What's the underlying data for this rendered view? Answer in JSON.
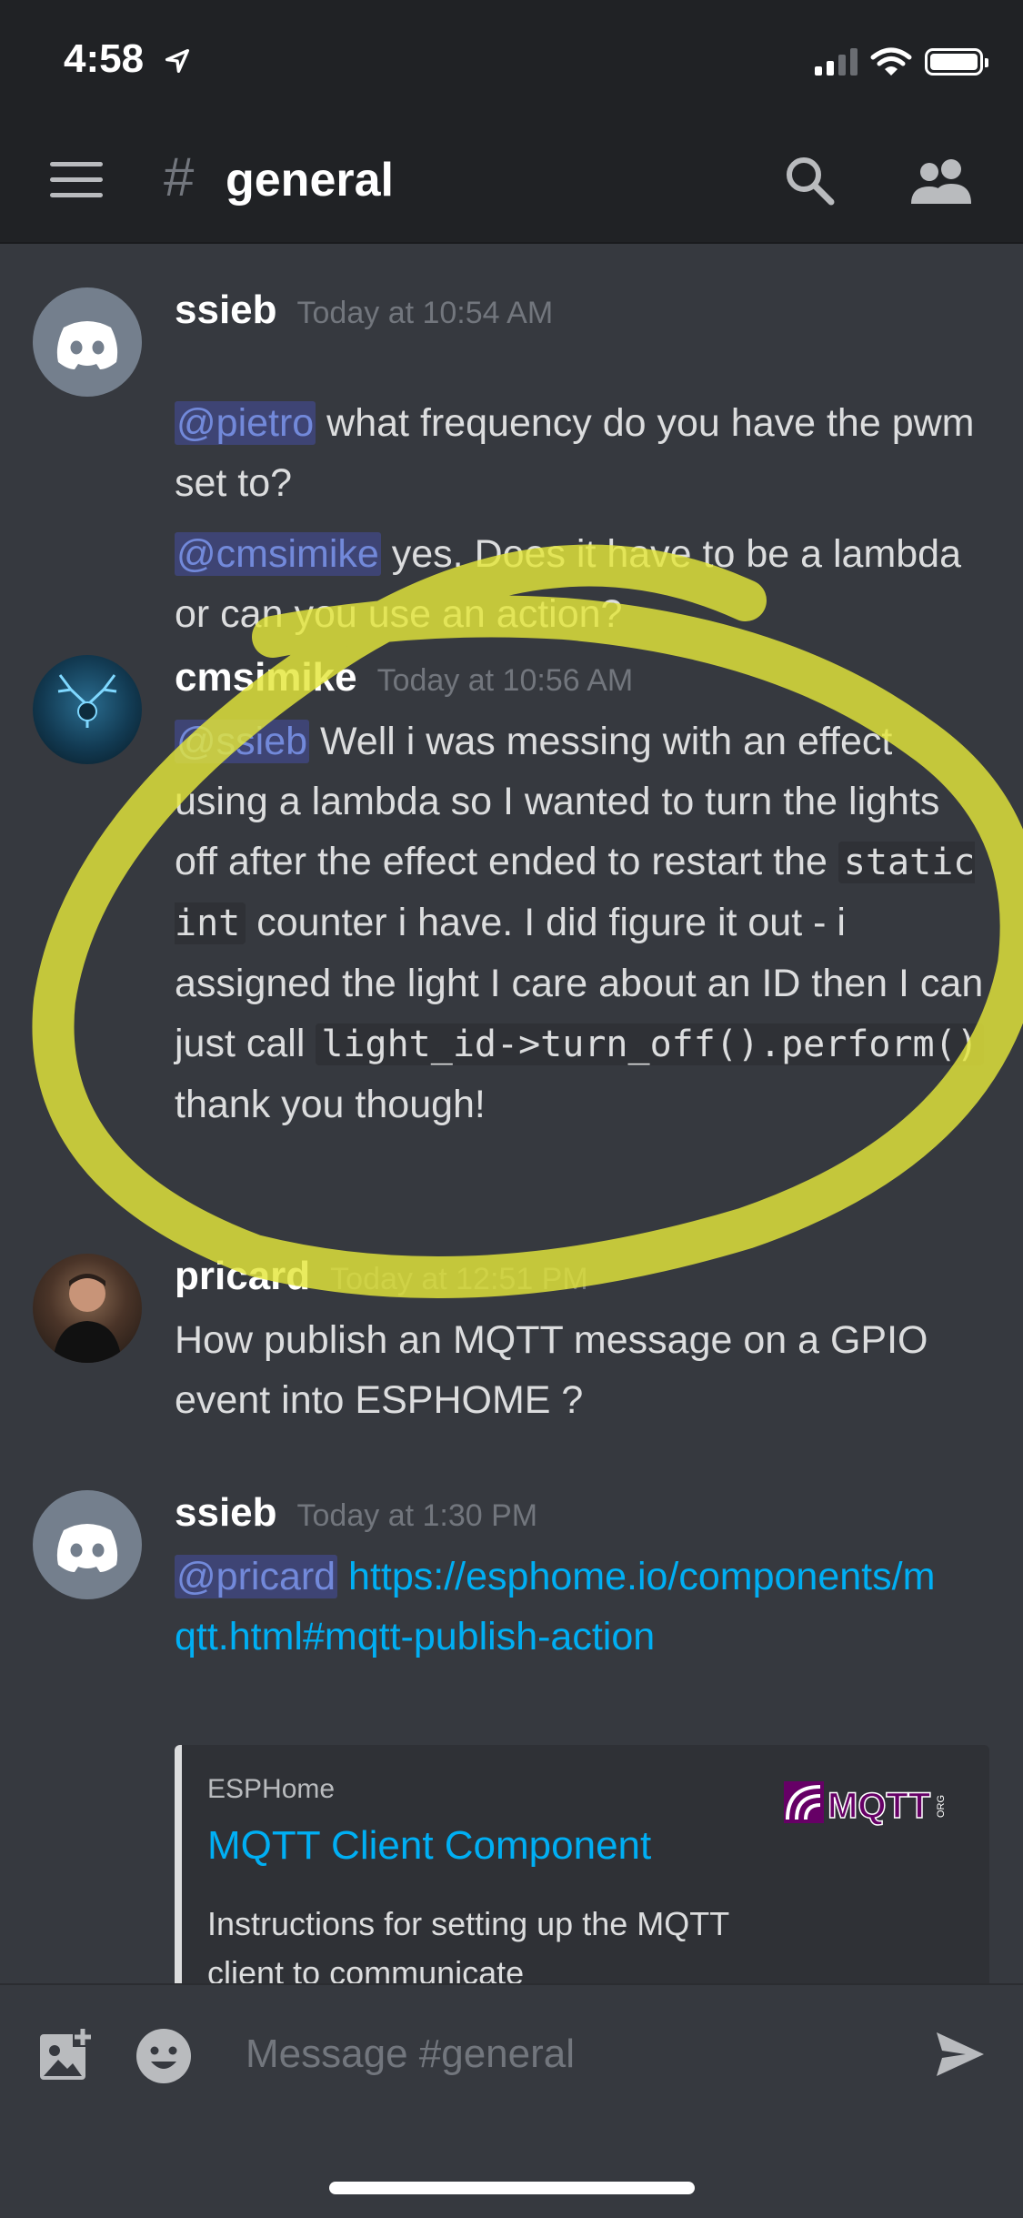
{
  "status_bar": {
    "time": "4:58"
  },
  "header": {
    "hash_symbol": "#",
    "channel_name": "general"
  },
  "messages": [
    {
      "username": "ssieb",
      "timestamp": "Today at 10:54 AM",
      "paragraphs": [
        {
          "mention": "@pietro",
          "text": " what frequency do you have the pwm set to?"
        },
        {
          "mention": "@cmsimike",
          "text": " yes.  Does it have to be a lambda or can you use an action?"
        }
      ]
    },
    {
      "username": "cmsimike",
      "timestamp": "Today at 10:56 AM",
      "mention": "@ssieb",
      "text_1": " Well i was messing with an effect using a lambda so I wanted to turn the lights off after the effect ended to restart the ",
      "code_1": "static int",
      "text_2": " counter i have. I did figure it out - i assigned the light I care about an ID then I can just call ",
      "code_2": "light_id->turn_off().perform()",
      "text_3": "thank you though!"
    },
    {
      "username": "pricard",
      "timestamp": "Today at 12:51 PM",
      "text": "How publish an MQTT message on a GPIO event into ESPHOME ?"
    },
    {
      "username": "ssieb",
      "timestamp": "Today at 1:30 PM",
      "mention": "@pricard",
      "link_text": "https://esphome.io/components/mqtt.html#mqtt-publish-action",
      "embed": {
        "provider": "ESPHome",
        "title": "MQTT Client Component",
        "description": "Instructions for setting up the MQTT client to communicate",
        "thumbnail_text": "MQTT",
        "thumbnail_suffix": "ORG"
      }
    }
  ],
  "composer": {
    "placeholder": "Message #general"
  },
  "colors": {
    "background": "#36393f",
    "header": "#202225",
    "mention": "#7289da",
    "link": "#00aff4",
    "annotation": "#e4e63a"
  },
  "icons": [
    "hamburger-icon",
    "search-icon",
    "members-icon",
    "image-icon",
    "emoji-icon",
    "send-icon"
  ]
}
